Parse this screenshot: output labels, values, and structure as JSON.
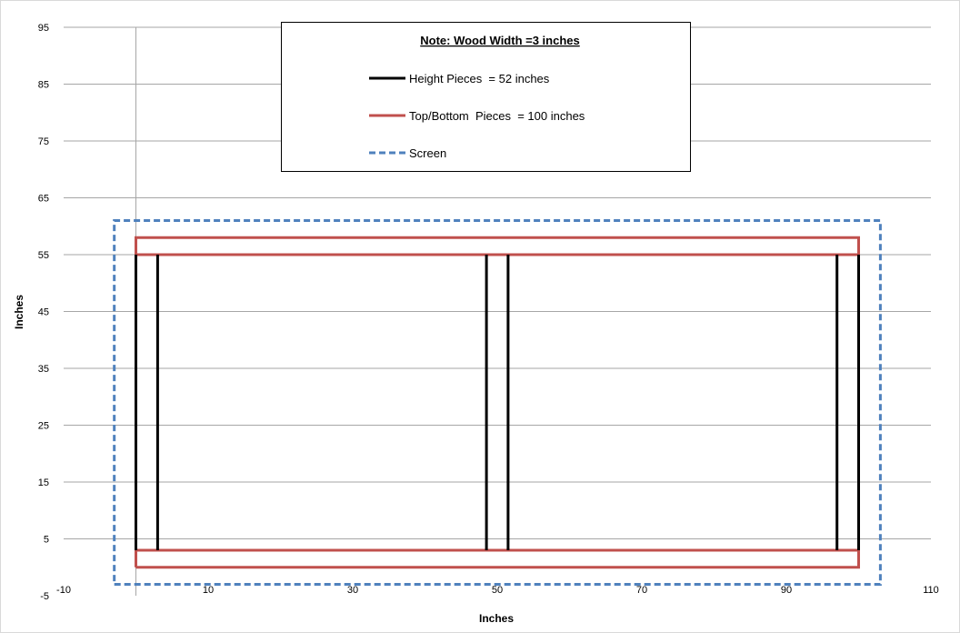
{
  "chart_data": {
    "type": "scatter",
    "xlabel": "Inches",
    "ylabel": "Inches",
    "xlim": [
      -10,
      110
    ],
    "ylim": [
      -5,
      95
    ],
    "x_ticks": [
      -10,
      10,
      30,
      50,
      70,
      90,
      110
    ],
    "y_ticks": [
      -5,
      5,
      15,
      25,
      35,
      45,
      55,
      65,
      75,
      85,
      95
    ],
    "grid": "horizontal",
    "legend_position": "top-center",
    "legend_title": "Note: Wood Width =3 inches",
    "colors": {
      "height": "#000000",
      "top_bottom": "#c0504d",
      "screen": "#4f81bd",
      "grid": "#a6a6a6"
    },
    "series": [
      {
        "name": "Height Pieces  = 52 inches",
        "line_style": "solid",
        "segments": [
          [
            [
              0,
              3
            ],
            [
              0,
              55
            ]
          ],
          [
            [
              3,
              3
            ],
            [
              3,
              55
            ]
          ],
          [
            [
              48.5,
              3
            ],
            [
              48.5,
              55
            ]
          ],
          [
            [
              51.5,
              3
            ],
            [
              51.5,
              55
            ]
          ],
          [
            [
              97,
              3
            ],
            [
              97,
              55
            ]
          ],
          [
            [
              100,
              3
            ],
            [
              100,
              55
            ]
          ]
        ]
      },
      {
        "name": "Top/Bottom  Pieces  = 100 inches",
        "line_style": "solid",
        "segments": [
          [
            [
              0,
              0
            ],
            [
              100,
              0
            ],
            [
              100,
              3
            ],
            [
              0,
              3
            ],
            [
              0,
              0
            ]
          ],
          [
            [
              0,
              55
            ],
            [
              100,
              55
            ],
            [
              100,
              58
            ],
            [
              0,
              58
            ],
            [
              0,
              55
            ]
          ]
        ]
      },
      {
        "name": "Screen",
        "line_style": "dashed",
        "segments": [
          [
            [
              -3,
              -3
            ],
            [
              103,
              -3
            ],
            [
              103,
              61
            ],
            [
              -3,
              61
            ],
            [
              -3,
              -3
            ]
          ]
        ]
      }
    ]
  }
}
